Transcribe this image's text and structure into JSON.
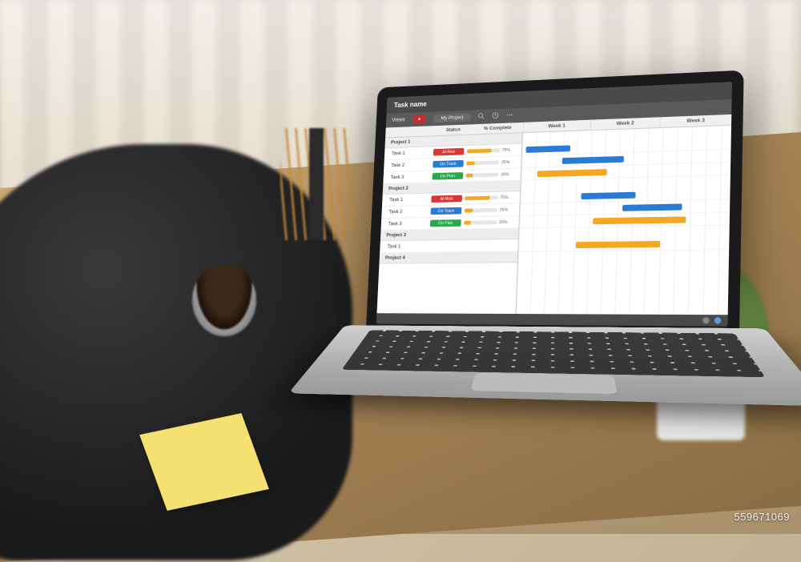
{
  "header": {
    "title": "Task name"
  },
  "toolbar": {
    "views_label": "Views",
    "project_tab": "My Project",
    "record_badge": "●"
  },
  "columns": {
    "task": "",
    "status": "Status",
    "complete": "% Complete"
  },
  "timeline": {
    "weeks": [
      "Week 1",
      "Week 2",
      "Week 3"
    ]
  },
  "groups": [
    {
      "name": "Project 1",
      "tasks": [
        {
          "name": "Task 1",
          "status": "At Risk",
          "status_class": "st-risk",
          "pct": 75,
          "bar": {
            "color": "blue",
            "start": 2,
            "span": 22
          }
        },
        {
          "name": "Task 2",
          "status": "On Track",
          "status_class": "st-track",
          "pct": 25,
          "bar": {
            "color": "blue",
            "start": 20,
            "span": 30
          }
        },
        {
          "name": "Task 3",
          "status": "On Plan",
          "status_class": "st-plan",
          "pct": 20,
          "bar": {
            "color": "orange",
            "start": 8,
            "span": 34
          }
        }
      ]
    },
    {
      "name": "Project 2",
      "tasks": [
        {
          "name": "Task 1",
          "status": "At Risk",
          "status_class": "st-risk",
          "pct": 75,
          "bar": {
            "color": "blue",
            "start": 30,
            "span": 26
          }
        },
        {
          "name": "Task 2",
          "status": "On Track",
          "status_class": "st-track",
          "pct": 25,
          "bar": {
            "color": "blue",
            "start": 50,
            "span": 28
          }
        },
        {
          "name": "Task 3",
          "status": "On Plan",
          "status_class": "st-plan",
          "pct": 20,
          "bar": {
            "color": "orange",
            "start": 36,
            "span": 44
          }
        }
      ]
    },
    {
      "name": "Project 3",
      "tasks": [
        {
          "name": "Task 1",
          "status": "",
          "status_class": "",
          "pct": null,
          "bar": {
            "color": "orange",
            "start": 28,
            "span": 40
          }
        }
      ]
    },
    {
      "name": "Project 4",
      "tasks": []
    }
  ],
  "watermark": "559671069",
  "colors": {
    "blue": "#2a7bd4",
    "orange": "#f5a623",
    "red": "#d93636",
    "green": "#2aa84a"
  }
}
